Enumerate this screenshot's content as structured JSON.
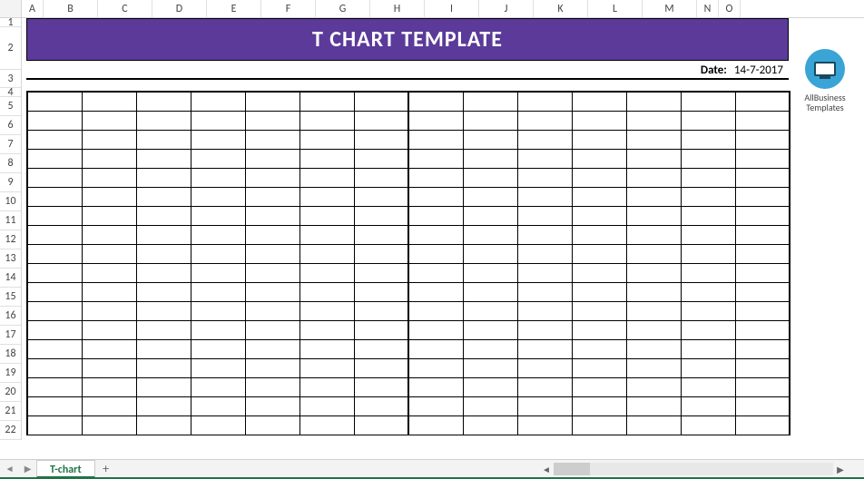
{
  "columns": [
    "A",
    "B",
    "C",
    "D",
    "E",
    "F",
    "G",
    "H",
    "I",
    "J",
    "K",
    "L",
    "M",
    "N",
    "O"
  ],
  "rows": [
    "1",
    "2",
    "3",
    "4",
    "5",
    "6",
    "7",
    "8",
    "9",
    "10",
    "11",
    "12",
    "13",
    "14",
    "15",
    "16",
    "17",
    "18",
    "19",
    "20",
    "21",
    "22"
  ],
  "banner_title": "T CHART TEMPLATE",
  "date_label": "Date:",
  "date_value": "14-7-2017",
  "logo": {
    "line1": "AllBusiness",
    "line2": "Templates"
  },
  "tabs": {
    "active": "T-chart",
    "add_label": "+"
  },
  "tab_nav": {
    "left": "◄",
    "right": "▶"
  },
  "hscroll": {
    "left": "◄",
    "right": "▶"
  },
  "tchart": {
    "rows": 18,
    "cols": 14,
    "mid_after_col": 7
  }
}
